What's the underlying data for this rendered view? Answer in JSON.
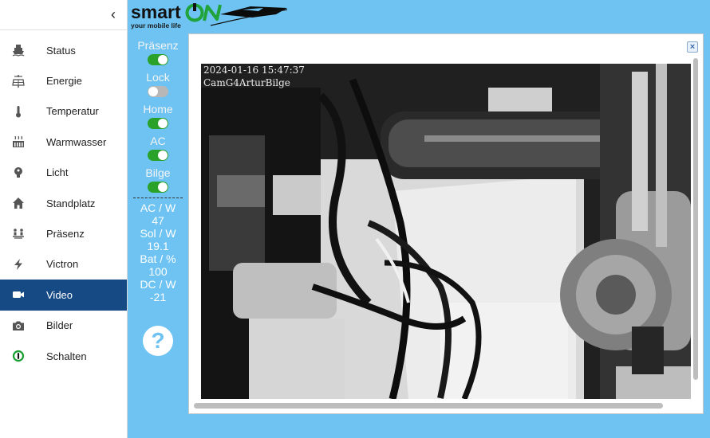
{
  "sidebar": {
    "collapse_glyph": "‹",
    "active": "Video",
    "items": [
      {
        "label": "Status",
        "icon": "ship-icon"
      },
      {
        "label": "Energie",
        "icon": "solar-panel-icon"
      },
      {
        "label": "Temperatur",
        "icon": "thermometer-icon"
      },
      {
        "label": "Warmwasser",
        "icon": "heater-icon"
      },
      {
        "label": "Licht",
        "icon": "lightbulb-icon"
      },
      {
        "label": "Standplatz",
        "icon": "home-icon"
      },
      {
        "label": "Präsenz",
        "icon": "presence-icon"
      },
      {
        "label": "Victron",
        "icon": "lightning-icon"
      },
      {
        "label": "Video",
        "icon": "video-camera-icon"
      },
      {
        "label": "Bilder",
        "icon": "photo-camera-icon"
      },
      {
        "label": "Schalten",
        "icon": "power-switch-icon"
      }
    ]
  },
  "logo": {
    "text": "smartON",
    "tagline": "your mobile life"
  },
  "toggles": [
    {
      "label": "Präsenz",
      "on": true
    },
    {
      "label": "Lock",
      "on": false
    },
    {
      "label": "Home",
      "on": true
    },
    {
      "label": "AC",
      "on": true
    },
    {
      "label": "Bilge",
      "on": true
    }
  ],
  "metrics": [
    {
      "label": "AC / W",
      "value": "47"
    },
    {
      "label": "Sol / W",
      "value": "19.1"
    },
    {
      "label": "Bat / %",
      "value": "100"
    },
    {
      "label": "DC / W",
      "value": "-21"
    }
  ],
  "help": {
    "glyph": "?"
  },
  "video": {
    "close_glyph": "×",
    "timestamp": "2024-01-16 15:47:37",
    "camera_name": "CamG4ArturBilge"
  },
  "colors": {
    "background": "#6ec3f2",
    "active_nav": "#154a85",
    "toggle_on": "#2aa22a",
    "toggle_off": "#b7b7b7"
  }
}
